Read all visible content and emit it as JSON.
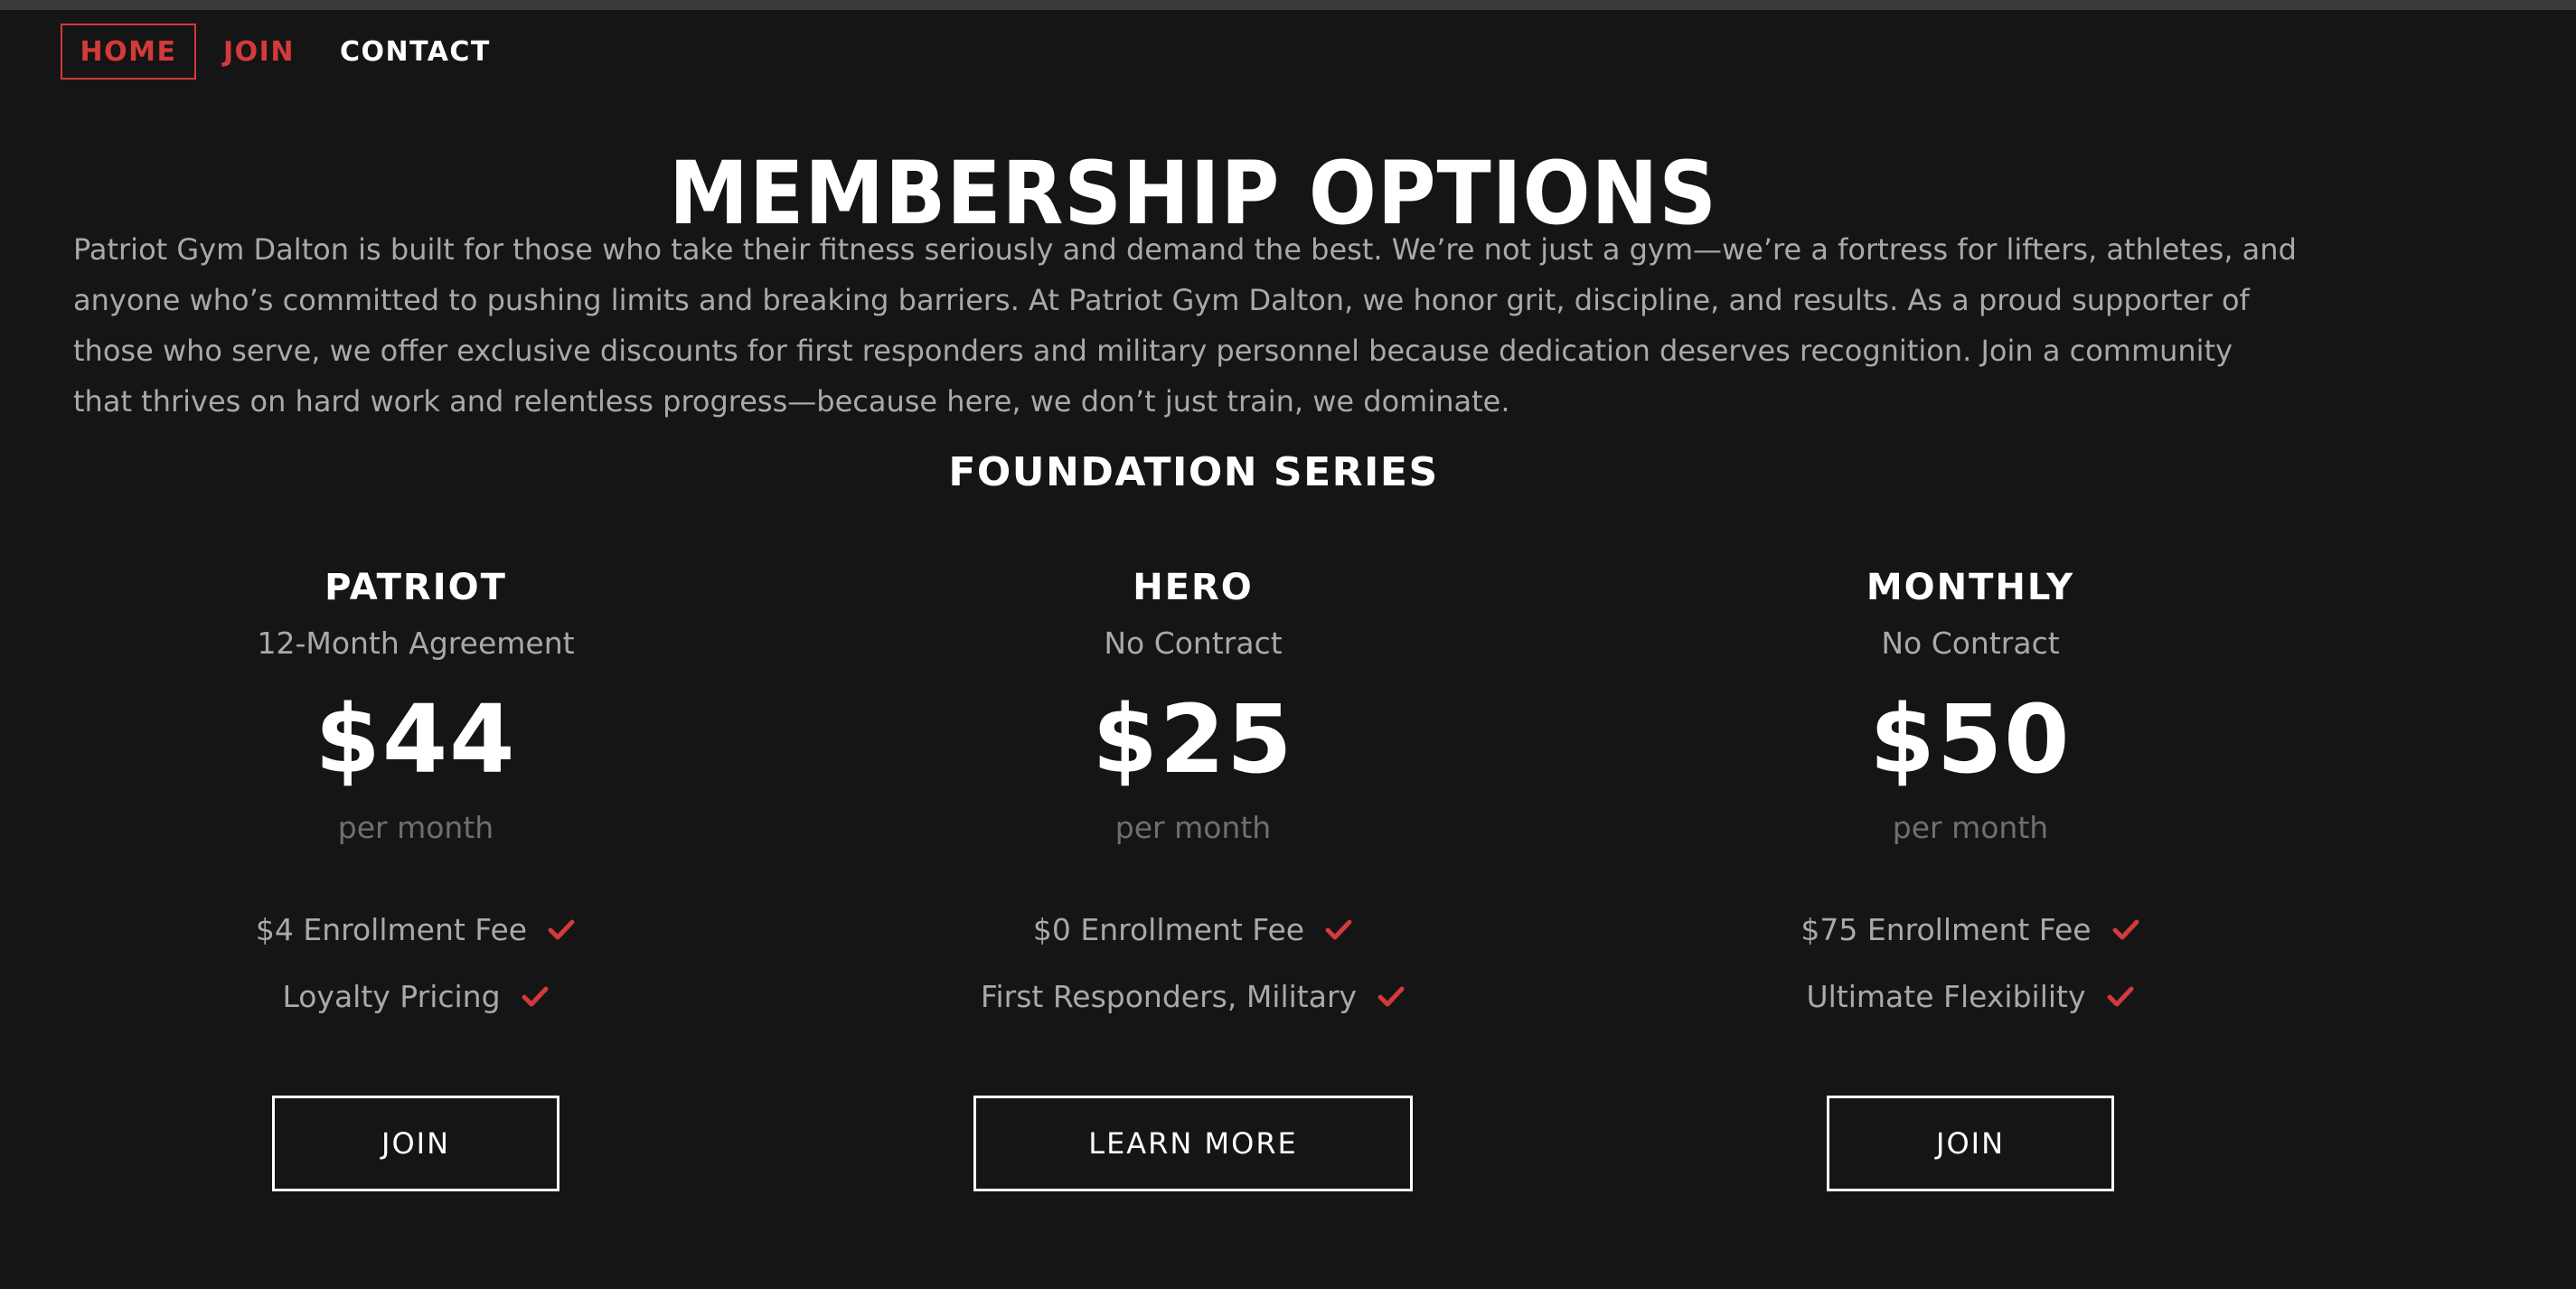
{
  "nav": {
    "home": "HOME",
    "join": "JOIN",
    "contact": "CONTACT"
  },
  "page": {
    "title": "MEMBERSHIP OPTIONS",
    "intro": "Patriot Gym Dalton is built for those who take their fitness seriously and demand the best. We’re not just a gym—we’re a fortress for lifters, athletes, and anyone who’s committed to pushing limits and breaking barriers. At Patriot Gym Dalton, we honor grit, discipline, and results. As a proud supporter of those who serve, we offer exclusive discounts for first responders and military personnel because dedication deserves recognition. Join a community that thrives on hard work and relentless progress—because here, we don’t just train, we dominate.",
    "series": "FOUNDATION SERIES"
  },
  "plans": [
    {
      "name": "PATRIOT",
      "term": "12-Month Agreement",
      "price": "$44",
      "period": "per month",
      "features": [
        "$4 Enrollment Fee",
        "Loyalty Pricing"
      ],
      "button": "JOIN"
    },
    {
      "name": "HERO",
      "term": "No Contract",
      "price": "$25",
      "period": "per month",
      "features": [
        "$0 Enrollment Fee",
        "First Responders, Military"
      ],
      "button": "LEARN MORE"
    },
    {
      "name": "MONTHLY",
      "term": "No Contract",
      "price": "$50",
      "period": "per month",
      "features": [
        "$75 Enrollment Fee",
        "Ultimate Flexibility"
      ],
      "button": "JOIN"
    }
  ],
  "icons": {
    "feature": "check-icon"
  },
  "colors": {
    "background": "#151515",
    "accent": "#d33a3a",
    "text": "#ffffff",
    "muted": "#a9a9a9",
    "dim": "#6f6f6f"
  }
}
